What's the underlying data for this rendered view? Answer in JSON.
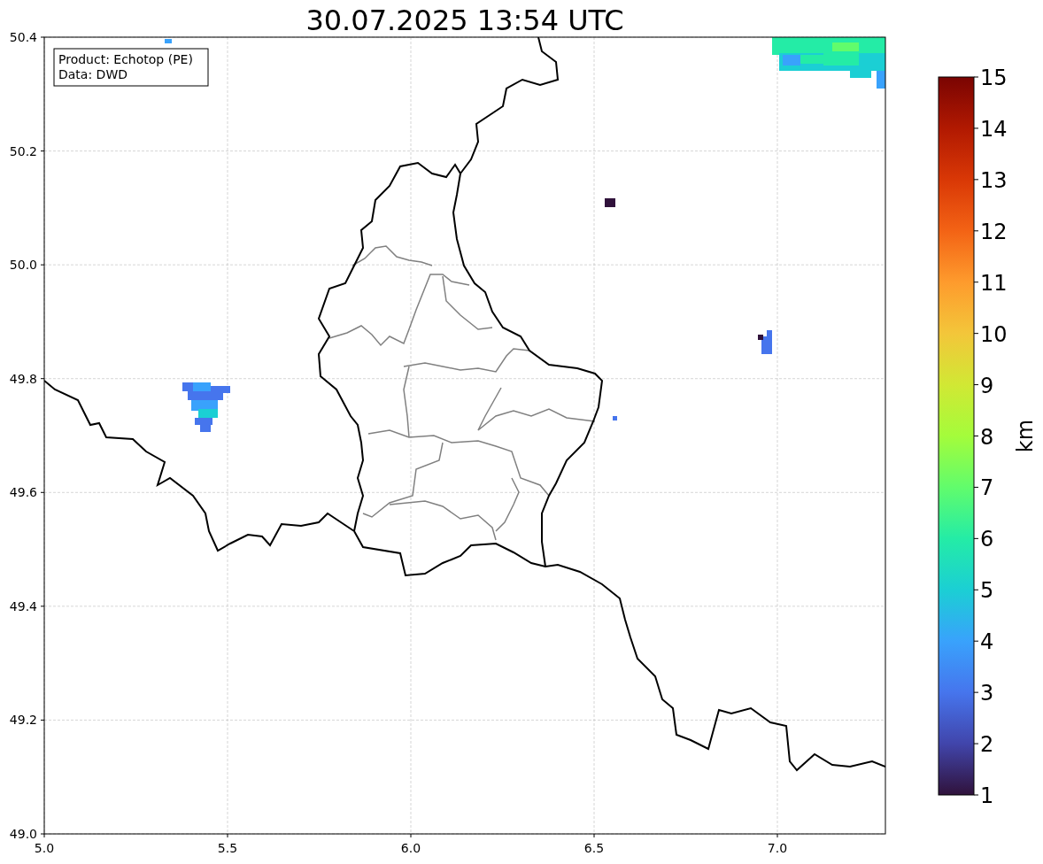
{
  "title": "30.07.2025 13:54 UTC",
  "info_box": [
    "Product: Echotop (PE)",
    "Data: DWD"
  ],
  "x_tick_labels": [
    "5.0",
    "5.5",
    "6.0",
    "6.5",
    "7.0"
  ],
  "y_tick_labels": [
    "50.4",
    "50.2",
    "50.0",
    "49.8",
    "49.6",
    "49.4",
    "49.2",
    "49.0"
  ],
  "colorbar": {
    "ticks": [
      "15",
      "14",
      "13",
      "12",
      "11",
      "10",
      "9",
      "8",
      "7",
      "6",
      "5",
      "4",
      "3",
      "2",
      "1"
    ],
    "label": "km"
  }
}
